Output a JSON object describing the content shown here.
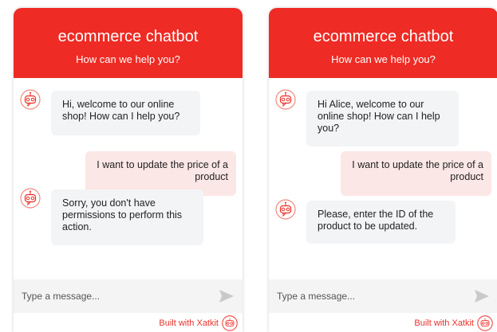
{
  "colors": {
    "brand_red": "#ee2b24",
    "bot_bubble": "#f3f4f6",
    "user_bubble": "#fbe7e5",
    "composer_bg": "#f4f4f5"
  },
  "left_panel": {
    "title": "ecommerce chatbot",
    "subtitle": "How can we help you?",
    "messages": {
      "m1": "Hi, welcome to our online shop! How can I help you?",
      "m2": "I want to update the price of a product",
      "m3": "Sorry, you don't have permissions to perform this action."
    },
    "placeholder": "Type a message...",
    "built_with": "Built with Xatkit"
  },
  "right_panel": {
    "title": "ecommerce chatbot",
    "subtitle": "How can we help you?",
    "messages": {
      "m1": "Hi Alice, welcome to our online shop! How can I help you?",
      "m2": "I want to update the price of a product",
      "m3": "Please, enter the ID of the product to be updated."
    },
    "placeholder": "Type a message...",
    "built_with": "Built with Xatkit"
  },
  "icons": {
    "avatar": "robot-avatar-icon",
    "send": "send-arrow-icon",
    "brand": "xatkit-robot-icon"
  }
}
